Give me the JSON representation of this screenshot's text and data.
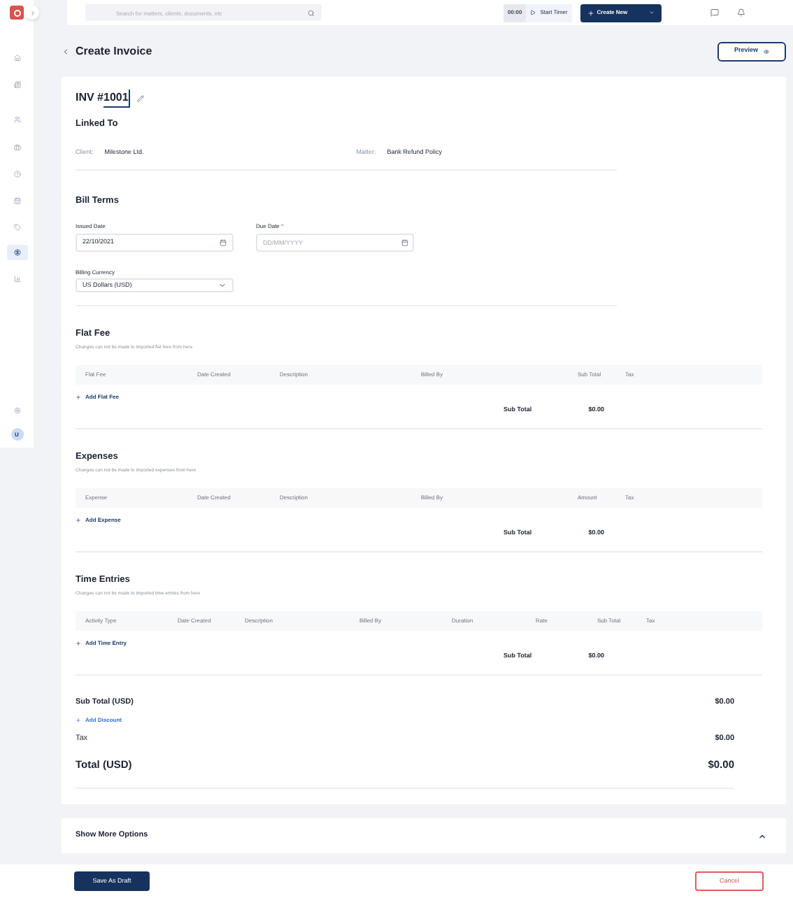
{
  "sidebar": {
    "items": [
      {
        "selected": false
      },
      {
        "selected": false
      },
      {
        "selected": false
      },
      {
        "selected": false
      },
      {
        "selected": false
      },
      {
        "selected": false
      },
      {
        "selected": false
      },
      {
        "selected": true
      },
      {
        "selected": false
      }
    ],
    "avatar": "U"
  },
  "header": {
    "search": {
      "placeholder": "Search for matters, clients, documents, etc"
    },
    "timer": "00:00",
    "start_timer": "Start Timer",
    "create_new": "Create New"
  },
  "page_title": "Create Invoice",
  "preview_button": "Preview",
  "invoice": {
    "prefix": "INV #",
    "number": "1001"
  },
  "linked_to": {
    "title": "Linked To",
    "client_label": "Client:",
    "client": "Milestone Ltd.",
    "matter_label": "Matter:",
    "matter": "Bank Refund Policy"
  },
  "bill_terms": {
    "title": "Bill Terms",
    "issued_date": {
      "label": "Issued Date",
      "value": "22/10/2021"
    },
    "due_date": {
      "label": "Due Date",
      "required": true,
      "required_mark": "*",
      "placeholder": "DD/MM/YYYY"
    },
    "billing_currency": {
      "label": "Billing Currency",
      "value": "US Dollars (USD)"
    }
  },
  "sections": [
    {
      "title": "Flat Fee",
      "note": "Changes can not be made to imported flat fees from here",
      "columns": [
        "Flat Fee",
        "Date Created",
        "Description",
        "Billed By",
        "Sub Total",
        "Tax"
      ],
      "add_label": "Add Flat Fee",
      "subtotal_label": "Sub Total",
      "subtotal": "$0.00"
    },
    {
      "title": "Expenses",
      "note": "Changes can not be made to imported expenses from here",
      "columns": [
        "Expense",
        "Date Created",
        "Description",
        "Billed By",
        "Amount",
        "Tax"
      ],
      "add_label": "Add Expense",
      "subtotal_label": "Sub Total",
      "subtotal": "$0.00"
    },
    {
      "title": "Time Entries",
      "note": "Changes can not be made to imported time entries from here",
      "columns": [
        "Activity Type",
        "Date Created",
        "Description",
        "Billed By",
        "Duration",
        "Rate",
        "Sub Total",
        "Tax"
      ],
      "add_label": "Add Time Entry",
      "subtotal_label": "Sub Total",
      "subtotal": "$0.00"
    }
  ],
  "summary": {
    "subtotal_label": "Sub Total (USD)",
    "subtotal": "$0.00",
    "add_discount": "Add Discount",
    "tax_label": "Tax",
    "tax": "$0.00",
    "total_label": "Total (USD)",
    "total": "$0.00"
  },
  "show_more": "Show More Options",
  "footer": {
    "save_draft": "Save As Draft",
    "cancel": "Cancel"
  }
}
